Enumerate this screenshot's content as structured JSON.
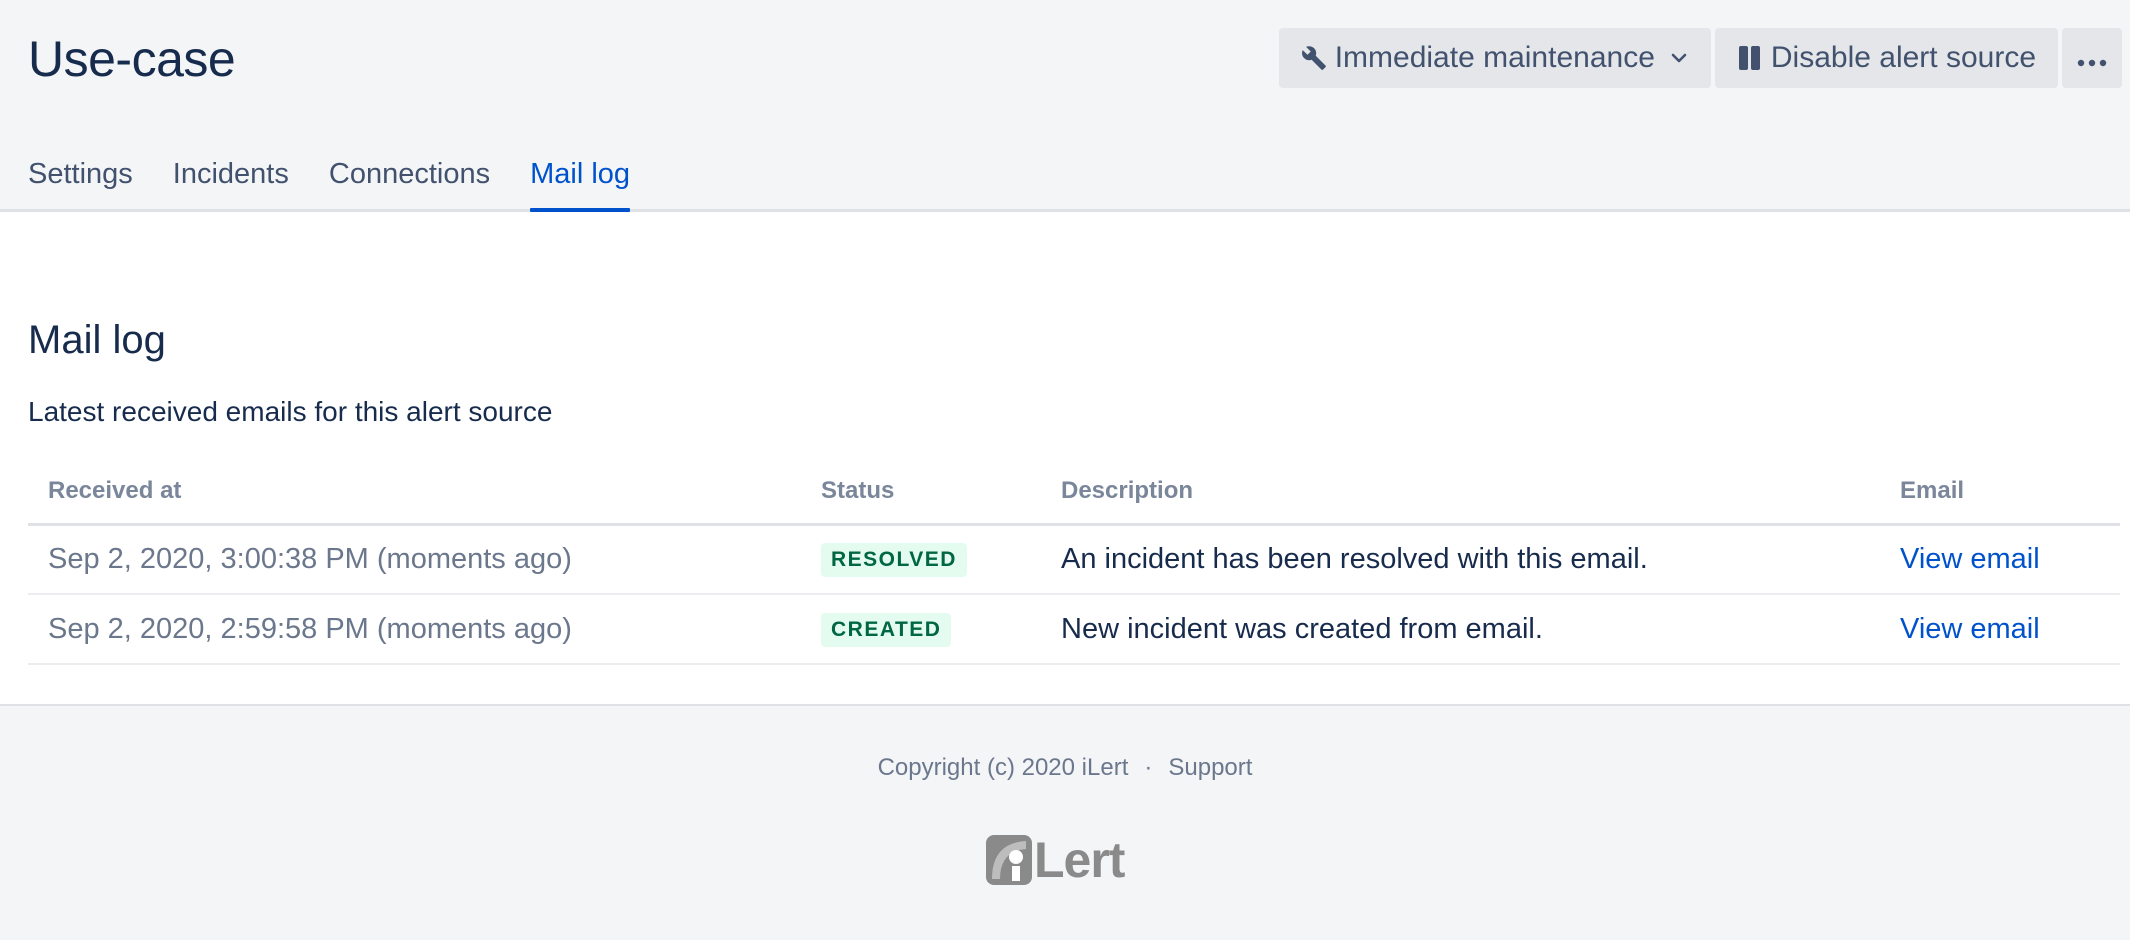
{
  "header": {
    "title": "Use-case",
    "actions": {
      "maintenance_label": "Immediate maintenance",
      "disable_label": "Disable alert source",
      "more_label": "···"
    },
    "tabs": [
      {
        "label": "Settings",
        "active": false
      },
      {
        "label": "Incidents",
        "active": false
      },
      {
        "label": "Connections",
        "active": false
      },
      {
        "label": "Mail log",
        "active": true
      }
    ]
  },
  "main": {
    "title": "Mail log",
    "description": "Latest received emails for this alert source",
    "table": {
      "columns": [
        "Received at",
        "Status",
        "Description",
        "Email"
      ],
      "rows": [
        {
          "received_at": "Sep 2, 2020, 3:00:38 PM (moments ago)",
          "status": "RESOLVED",
          "description": "An incident has been resolved with this email.",
          "email_link": "View email"
        },
        {
          "received_at": "Sep 2, 2020, 2:59:58 PM (moments ago)",
          "status": "CREATED",
          "description": "New incident was created from email.",
          "email_link": "View email"
        }
      ]
    }
  },
  "footer": {
    "copyright": "Copyright (c) 2020 iLert",
    "separator": "·",
    "support_label": "Support",
    "logo_text": "iLert"
  },
  "colors": {
    "accent": "#0052cc",
    "text": "#172b4d",
    "badge_bg": "#e3fcef",
    "badge_text": "#006644"
  },
  "icons": {
    "maintenance": "wrench-icon",
    "dropdown": "chevron-down-icon",
    "disable": "pause-icon",
    "more": "more-icon"
  }
}
